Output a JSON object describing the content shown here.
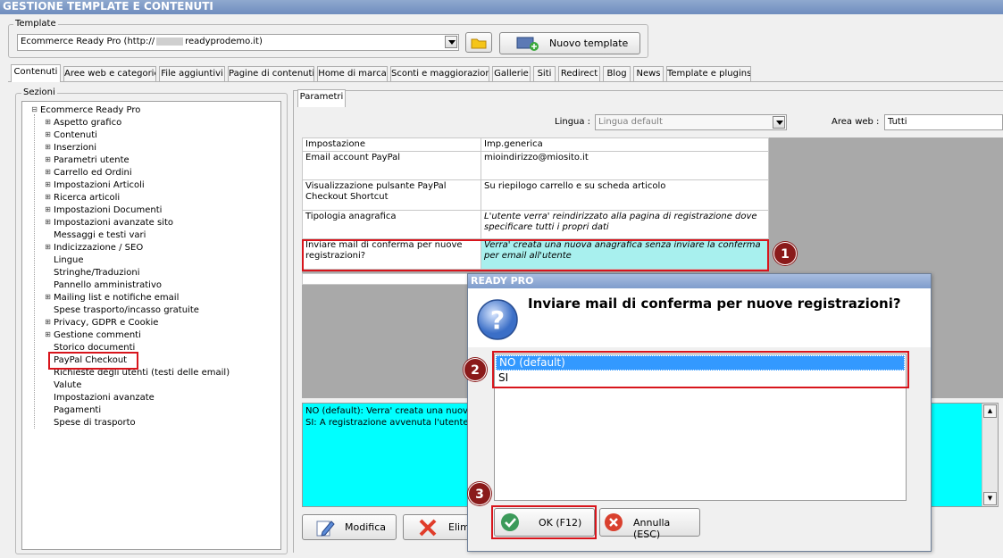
{
  "window": {
    "title": "GESTIONE TEMPLATE E CONTENUTI"
  },
  "template": {
    "group_label": "Template",
    "selected": "Ecommerce Ready Pro (http://",
    "selected_suffix": "readyprodemo.it)",
    "new_button": "Nuovo template"
  },
  "tabs": [
    "Contenuti",
    "Aree web e categorie",
    "File aggiuntivi",
    "Pagine di contenuti",
    "Home di marca",
    "Sconti e maggiorazioni",
    "Gallerie",
    "Siti",
    "Redirect",
    "Blog",
    "News",
    "Template e plugins"
  ],
  "sidebar": {
    "group_label": "Sezioni",
    "root": "Ecommerce Ready Pro",
    "items": [
      {
        "label": "Aspetto grafico",
        "expandable": true
      },
      {
        "label": "Contenuti",
        "expandable": true
      },
      {
        "label": "Inserzioni",
        "expandable": true
      },
      {
        "label": "Parametri utente",
        "expandable": true
      },
      {
        "label": "Carrello ed Ordini",
        "expandable": true
      },
      {
        "label": "Impostazioni Articoli",
        "expandable": true
      },
      {
        "label": "Ricerca articoli",
        "expandable": true
      },
      {
        "label": "Impostazioni Documenti",
        "expandable": true
      },
      {
        "label": "Impostazioni avanzate sito",
        "expandable": true
      },
      {
        "label": "Messaggi e testi vari",
        "expandable": false
      },
      {
        "label": "Indicizzazione / SEO",
        "expandable": true
      },
      {
        "label": "Lingue",
        "expandable": false
      },
      {
        "label": "Stringhe/Traduzioni",
        "expandable": false
      },
      {
        "label": "Pannello amministrativo",
        "expandable": false
      },
      {
        "label": "Mailing list e notifiche email",
        "expandable": true
      },
      {
        "label": "Spese trasporto/incasso gratuite",
        "expandable": false
      },
      {
        "label": "Privacy, GDPR e Cookie",
        "expandable": true
      },
      {
        "label": "Gestione commenti",
        "expandable": true
      },
      {
        "label": "Storico documenti",
        "expandable": false
      },
      {
        "label": "PayPal Checkout",
        "expandable": false
      },
      {
        "label": "Richieste degli utenti (testi delle email)",
        "expandable": false
      },
      {
        "label": "Valute",
        "expandable": false
      },
      {
        "label": "Impostazioni avanzate",
        "expandable": false
      },
      {
        "label": "Pagamenti",
        "expandable": false
      },
      {
        "label": "Spese di trasporto",
        "expandable": false
      }
    ]
  },
  "params": {
    "tab": "Parametri",
    "lingua_label": "Lingua :",
    "lingua_value": "Lingua default",
    "area_label": "Area web :",
    "area_value": "Tutti",
    "headers": [
      "Impostazione",
      "Imp.generica"
    ],
    "rows": [
      {
        "setting": "Email account PayPal",
        "value": "mioindirizzo@miosito.it"
      },
      {
        "setting": "Visualizzazione pulsante PayPal Checkout Shortcut",
        "value": "Su riepilogo carrello e su scheda articolo"
      },
      {
        "setting": "Tipologia anagrafica",
        "value": "L'utente verra' reindirizzato alla pagina di registrazione dove specificare tutti i propri dati"
      },
      {
        "setting": "Inviare mail di conferma per nuove registrazioni?",
        "value": "Verra' creata una nuova anagrafica senza inviare la conferma per email all'utente"
      }
    ],
    "description_lines": [
      "NO (default): Verra' creata una nuova an",
      "SI: A registrazione avvenuta l'utente rice"
    ],
    "modify_button": "Modifica",
    "delete_button": "Elimi"
  },
  "dialog": {
    "title": "READY PRO",
    "question": "Inviare mail di conferma per nuove registrazioni?",
    "options": [
      "NO (default)",
      "SI"
    ],
    "ok_button": "OK (F12)",
    "cancel_button": "Annulla (ESC)"
  },
  "callouts": [
    "1",
    "2",
    "3"
  ],
  "colors": {
    "highlight": "#d8151c",
    "callout": "#8a1a1a",
    "selection": "#3399ff",
    "cyan": "#00ffff"
  }
}
